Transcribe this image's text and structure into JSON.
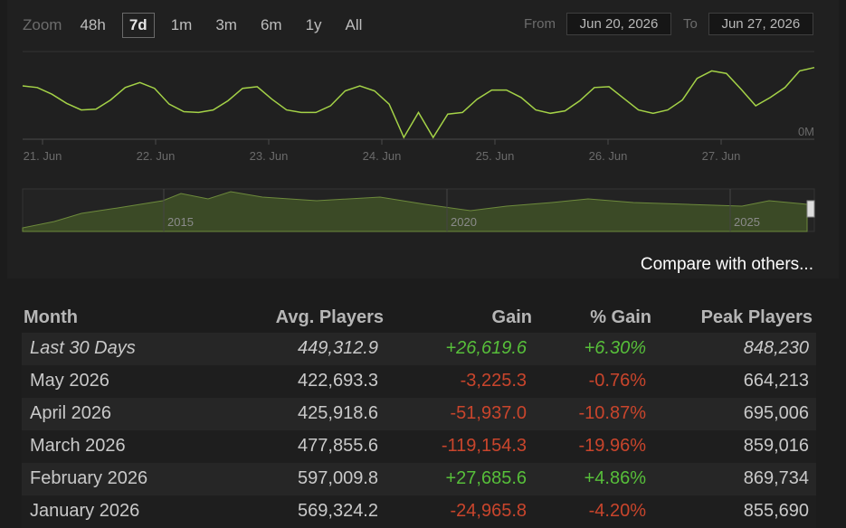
{
  "zoom": {
    "label": "Zoom",
    "options": [
      "48h",
      "7d",
      "1m",
      "3m",
      "6m",
      "1y",
      "All"
    ],
    "active": "7d"
  },
  "range": {
    "from_label": "From",
    "from_value": "Jun 20, 2026",
    "to_label": "To",
    "to_value": "Jun 27, 2026"
  },
  "chart_data": {
    "type": "line",
    "x_tick_labels": [
      "21. Jun",
      "22. Jun",
      "23. Jun",
      "24. Jun",
      "25. Jun",
      "26. Jun",
      "27. Jun"
    ],
    "y_axis_label": "0M",
    "line_color": "#a4d247",
    "series": [
      {
        "values_relative": [
          0.62,
          0.6,
          0.52,
          0.41,
          0.33,
          0.34,
          0.45,
          0.6,
          0.66,
          0.59,
          0.4,
          0.31,
          0.3,
          0.33,
          0.44,
          0.59,
          0.61,
          0.46,
          0.33,
          0.3,
          0.3,
          0.38,
          0.56,
          0.62,
          0.56,
          0.4,
          0.0,
          0.3,
          0.0,
          0.28,
          0.3,
          0.46,
          0.57,
          0.57,
          0.48,
          0.33,
          0.29,
          0.32,
          0.44,
          0.6,
          0.61,
          0.47,
          0.33,
          0.29,
          0.33,
          0.45,
          0.71,
          0.8,
          0.77,
          0.58,
          0.38,
          0.48,
          0.6,
          0.8,
          0.84
        ]
      }
    ],
    "overview": {
      "year_labels": [
        "2015",
        "2020",
        "2025"
      ],
      "fill_color": "#3b4a26"
    }
  },
  "compare_link": "Compare with others...",
  "table": {
    "headers": [
      "Month",
      "Avg. Players",
      "Gain",
      "% Gain",
      "Peak Players"
    ],
    "rows": [
      {
        "month": "Last 30 Days",
        "avg": "449,312.9",
        "gain": "+26,619.6",
        "pct": "+6.30%",
        "peak": "848,230",
        "trend": "pos"
      },
      {
        "month": "May 2026",
        "avg": "422,693.3",
        "gain": "-3,225.3",
        "pct": "-0.76%",
        "peak": "664,213",
        "trend": "neg"
      },
      {
        "month": "April 2026",
        "avg": "425,918.6",
        "gain": "-51,937.0",
        "pct": "-10.87%",
        "peak": "695,006",
        "trend": "neg"
      },
      {
        "month": "March 2026",
        "avg": "477,855.6",
        "gain": "-119,154.3",
        "pct": "-19.96%",
        "peak": "859,016",
        "trend": "neg"
      },
      {
        "month": "February 2026",
        "avg": "597,009.8",
        "gain": "+27,685.6",
        "pct": "+4.86%",
        "peak": "869,734",
        "trend": "pos"
      },
      {
        "month": "January 2026",
        "avg": "569,324.2",
        "gain": "-24,965.8",
        "pct": "-4.20%",
        "peak": "855,690",
        "trend": "neg"
      }
    ]
  }
}
